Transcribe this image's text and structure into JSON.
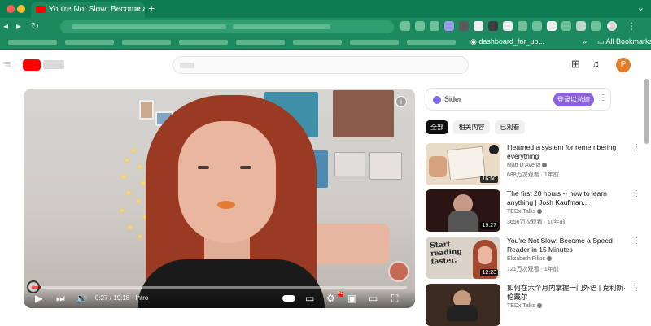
{
  "browser": {
    "tab_title": "You're Not Slow: Become a Sp",
    "tab_close": "×",
    "new_tab": "+",
    "tab_menu": "⌄",
    "bookmark_item": "dashboard_for_up...",
    "bookmarks_more": "»",
    "all_bookmarks": "All Bookmarks"
  },
  "youtube": {
    "avatar_letter": "P",
    "header_icons": {
      "create": "create-icon",
      "notifications": "bell-icon"
    }
  },
  "player": {
    "time": "0:27 / 19:18 · Intro",
    "progress_fraction": 0.023,
    "info": "i",
    "controls": {
      "play": "▶",
      "next": "⏭",
      "volume": "🔊",
      "settings": "⚙",
      "hd_badge": "HD",
      "fullscreen": "⛶"
    }
  },
  "sider": {
    "name": "Sider",
    "login": "登录以总结",
    "more": "⋮"
  },
  "chips": [
    {
      "label": "全部",
      "active": true
    },
    {
      "label": "相关内容",
      "active": false
    },
    {
      "label": "已观看",
      "active": false
    }
  ],
  "recommendations": [
    {
      "title": "I learned a system for remembering everything",
      "channel": "Matt D'Avella",
      "meta": "688万次观看 · 1年前",
      "duration": "16:50",
      "more": "⋮"
    },
    {
      "title": "The first 20 hours -- how to learn anything | Josh Kaufman...",
      "channel": "TEDx Talks",
      "meta": "3656万次观看 · 10年前",
      "duration": "19:27",
      "more": "⋮"
    },
    {
      "title": "You're Not Slow: Become a Speed Reader in 15 Minutes",
      "channel": "Elizabeth Filips",
      "meta": "121万次观看 · 1年前",
      "duration": "12:23",
      "thumb_text": "Start reading faster.",
      "more": "⋮"
    },
    {
      "title": "如何在六个月内掌握一门外语 | 克利斯·伦戴尔",
      "channel": "TEDx Talks",
      "meta": "",
      "duration": "",
      "more": "⋮"
    }
  ]
}
